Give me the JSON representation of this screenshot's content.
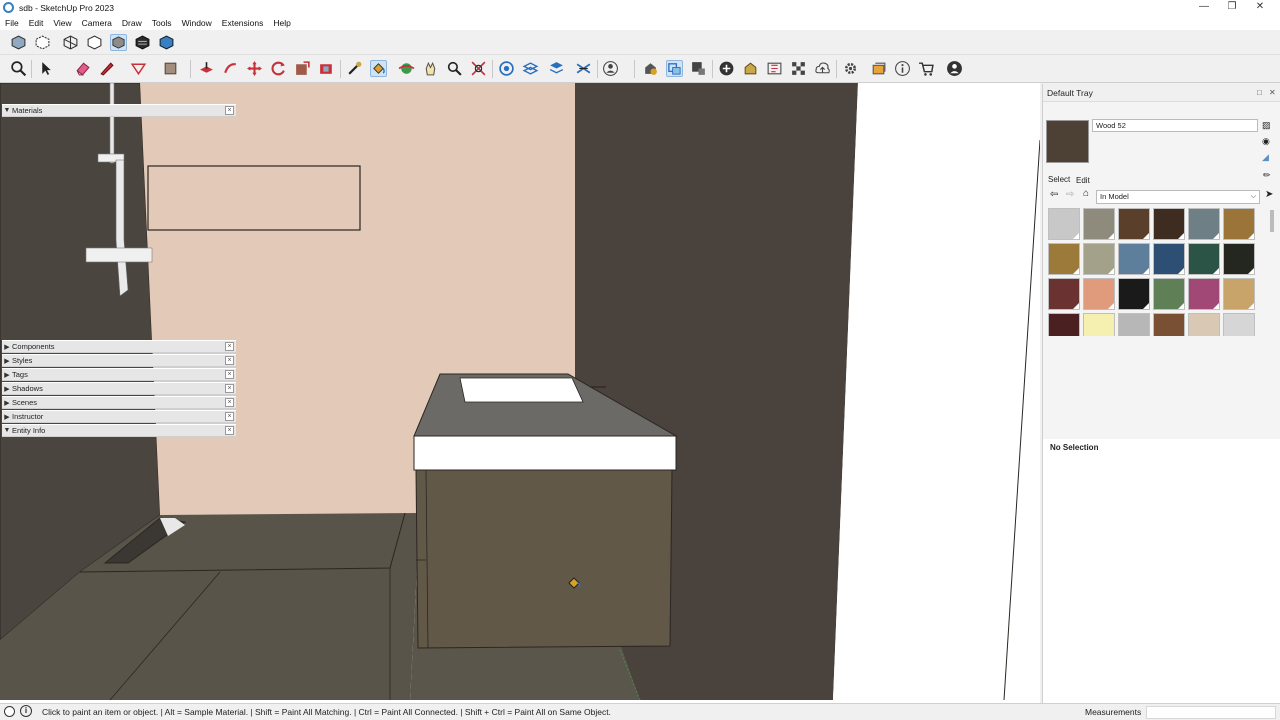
{
  "window": {
    "title": "sdb - SketchUp Pro 2023"
  },
  "menu": [
    "File",
    "Edit",
    "View",
    "Camera",
    "Draw",
    "Tools",
    "Window",
    "Extensions",
    "Help"
  ],
  "tray": {
    "title": "Default Tray",
    "materials": {
      "header": "Materials",
      "name": "Wood 52",
      "tab_select": "Select",
      "tab_edit": "Edit",
      "library": "In Model",
      "swatches": [
        "#c8c8c8",
        "#8e8a7c",
        "#5a3f2a",
        "#3f2c20",
        "#6f7f86",
        "#9a7439",
        "#9b7a3a",
        "#a3a189",
        "#5e7f9b",
        "#2e4f74",
        "#2c5446",
        "#242620",
        "#6b3232",
        "#e09a7c",
        "#1a1a1a",
        "#5f7f57",
        "#a24876",
        "#c9a46a",
        "#4a2020",
        "#f6f0b0",
        "#b7b7b7",
        "#7a5034",
        "#d9c8b4",
        "#d6d6d6"
      ]
    },
    "sections": [
      "Components",
      "Styles",
      "Tags",
      "Shadows",
      "Scenes",
      "Instructor",
      "Entity Info"
    ],
    "entity_info": "No Selection"
  },
  "status": {
    "hint": "Click to paint an item or object. | Alt = Sample Material. | Shift = Paint All Matching. | Ctrl = Paint All Connected. | Shift + Ctrl = Paint All on Same Object.",
    "measurements_label": "Measurements"
  },
  "colors": {
    "accent": "#3a7fc1",
    "wall_pink": "#e3c9b6",
    "wall_dark": "#4a423c",
    "cabinet": "#625848"
  }
}
